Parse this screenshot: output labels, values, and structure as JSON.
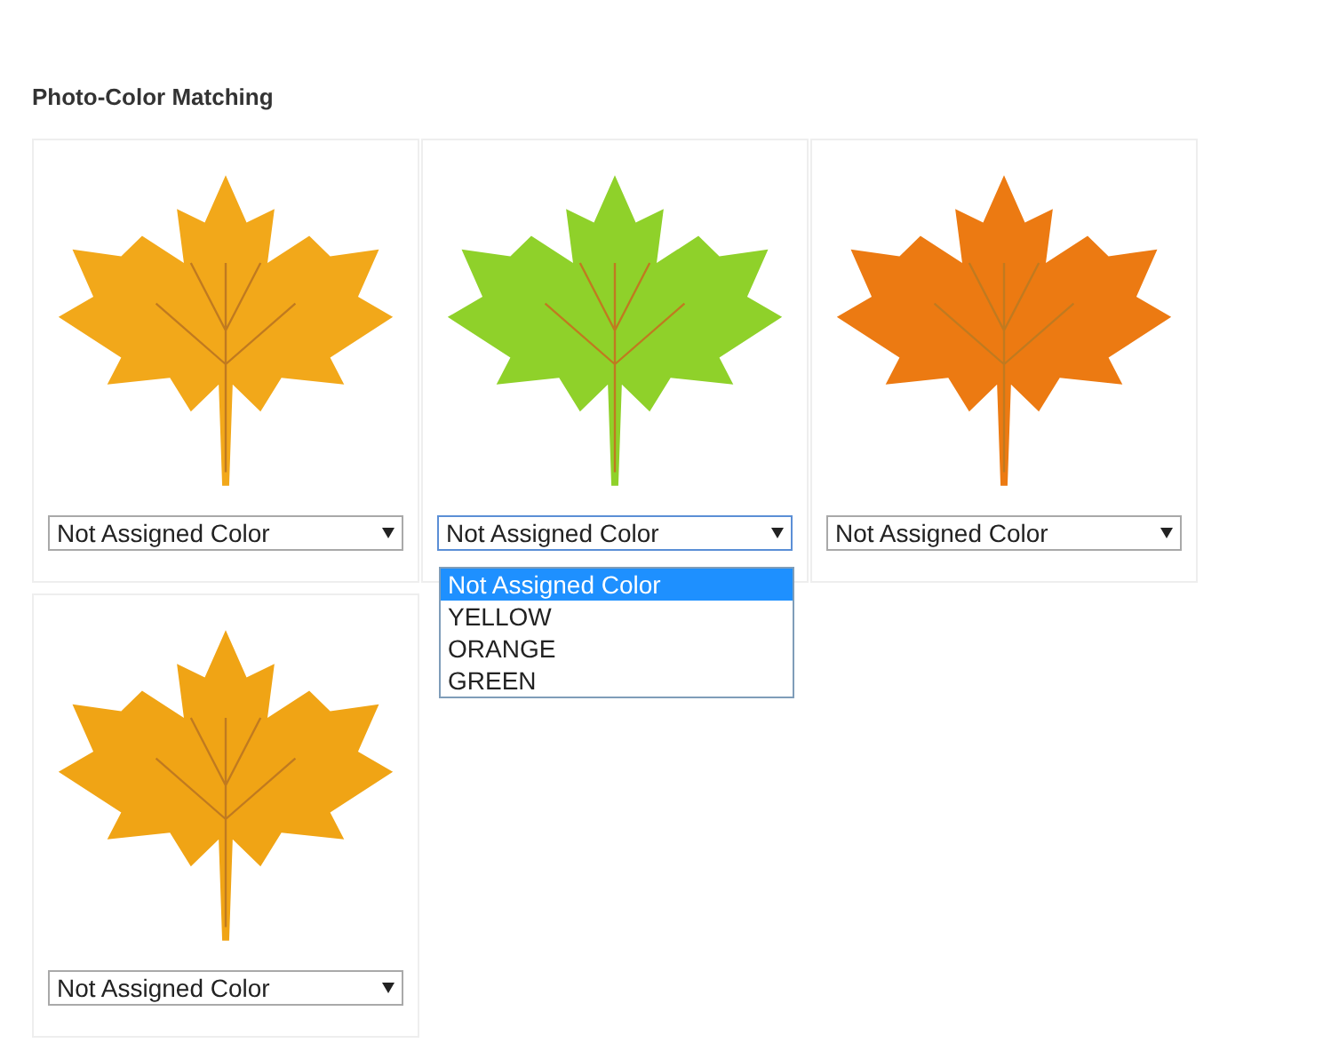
{
  "section_title": "Photo-Color Matching",
  "cards": [
    {
      "photo": {
        "color": "#f2a81a"
      },
      "dropdown": {
        "value": "Not Assigned Color",
        "expanded": false
      }
    },
    {
      "photo": {
        "color": "#8fd12a"
      },
      "dropdown": {
        "value": "Not Assigned Color",
        "expanded": true,
        "options": [
          {
            "label": "Not Assigned Color",
            "selected": true
          },
          {
            "label": "YELLOW",
            "selected": false
          },
          {
            "label": "ORANGE",
            "selected": false
          },
          {
            "label": "GREEN",
            "selected": false
          }
        ]
      }
    },
    {
      "photo": {
        "color": "#ec7a12"
      },
      "dropdown": {
        "value": "Not Assigned Color",
        "expanded": false
      }
    },
    {
      "photo": {
        "color": "#f0a415"
      },
      "dropdown": {
        "value": "Not Assigned Color",
        "expanded": false
      }
    }
  ]
}
